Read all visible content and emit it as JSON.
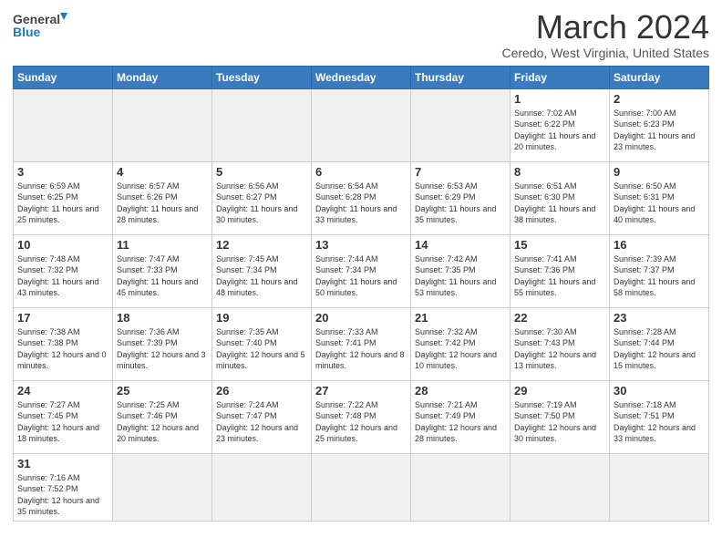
{
  "header": {
    "logo_general": "General",
    "logo_blue": "Blue",
    "title": "March 2024",
    "location": "Ceredo, West Virginia, United States"
  },
  "days_of_week": [
    "Sunday",
    "Monday",
    "Tuesday",
    "Wednesday",
    "Thursday",
    "Friday",
    "Saturday"
  ],
  "weeks": [
    [
      {
        "day": "",
        "info": ""
      },
      {
        "day": "",
        "info": ""
      },
      {
        "day": "",
        "info": ""
      },
      {
        "day": "",
        "info": ""
      },
      {
        "day": "",
        "info": ""
      },
      {
        "day": "1",
        "info": "Sunrise: 7:02 AM\nSunset: 6:22 PM\nDaylight: 11 hours\nand 20 minutes."
      },
      {
        "day": "2",
        "info": "Sunrise: 7:00 AM\nSunset: 6:23 PM\nDaylight: 11 hours\nand 23 minutes."
      }
    ],
    [
      {
        "day": "3",
        "info": "Sunrise: 6:59 AM\nSunset: 6:25 PM\nDaylight: 11 hours\nand 25 minutes."
      },
      {
        "day": "4",
        "info": "Sunrise: 6:57 AM\nSunset: 6:26 PM\nDaylight: 11 hours\nand 28 minutes."
      },
      {
        "day": "5",
        "info": "Sunrise: 6:56 AM\nSunset: 6:27 PM\nDaylight: 11 hours\nand 30 minutes."
      },
      {
        "day": "6",
        "info": "Sunrise: 6:54 AM\nSunset: 6:28 PM\nDaylight: 11 hours\nand 33 minutes."
      },
      {
        "day": "7",
        "info": "Sunrise: 6:53 AM\nSunset: 6:29 PM\nDaylight: 11 hours\nand 35 minutes."
      },
      {
        "day": "8",
        "info": "Sunrise: 6:51 AM\nSunset: 6:30 PM\nDaylight: 11 hours\nand 38 minutes."
      },
      {
        "day": "9",
        "info": "Sunrise: 6:50 AM\nSunset: 6:31 PM\nDaylight: 11 hours\nand 40 minutes."
      }
    ],
    [
      {
        "day": "10",
        "info": "Sunrise: 7:48 AM\nSunset: 7:32 PM\nDaylight: 11 hours\nand 43 minutes."
      },
      {
        "day": "11",
        "info": "Sunrise: 7:47 AM\nSunset: 7:33 PM\nDaylight: 11 hours\nand 45 minutes."
      },
      {
        "day": "12",
        "info": "Sunrise: 7:45 AM\nSunset: 7:34 PM\nDaylight: 11 hours\nand 48 minutes."
      },
      {
        "day": "13",
        "info": "Sunrise: 7:44 AM\nSunset: 7:34 PM\nDaylight: 11 hours\nand 50 minutes."
      },
      {
        "day": "14",
        "info": "Sunrise: 7:42 AM\nSunset: 7:35 PM\nDaylight: 11 hours\nand 53 minutes."
      },
      {
        "day": "15",
        "info": "Sunrise: 7:41 AM\nSunset: 7:36 PM\nDaylight: 11 hours\nand 55 minutes."
      },
      {
        "day": "16",
        "info": "Sunrise: 7:39 AM\nSunset: 7:37 PM\nDaylight: 11 hours\nand 58 minutes."
      }
    ],
    [
      {
        "day": "17",
        "info": "Sunrise: 7:38 AM\nSunset: 7:38 PM\nDaylight: 12 hours\nand 0 minutes."
      },
      {
        "day": "18",
        "info": "Sunrise: 7:36 AM\nSunset: 7:39 PM\nDaylight: 12 hours\nand 3 minutes."
      },
      {
        "day": "19",
        "info": "Sunrise: 7:35 AM\nSunset: 7:40 PM\nDaylight: 12 hours\nand 5 minutes."
      },
      {
        "day": "20",
        "info": "Sunrise: 7:33 AM\nSunset: 7:41 PM\nDaylight: 12 hours\nand 8 minutes."
      },
      {
        "day": "21",
        "info": "Sunrise: 7:32 AM\nSunset: 7:42 PM\nDaylight: 12 hours\nand 10 minutes."
      },
      {
        "day": "22",
        "info": "Sunrise: 7:30 AM\nSunset: 7:43 PM\nDaylight: 12 hours\nand 13 minutes."
      },
      {
        "day": "23",
        "info": "Sunrise: 7:28 AM\nSunset: 7:44 PM\nDaylight: 12 hours\nand 15 minutes."
      }
    ],
    [
      {
        "day": "24",
        "info": "Sunrise: 7:27 AM\nSunset: 7:45 PM\nDaylight: 12 hours\nand 18 minutes."
      },
      {
        "day": "25",
        "info": "Sunrise: 7:25 AM\nSunset: 7:46 PM\nDaylight: 12 hours\nand 20 minutes."
      },
      {
        "day": "26",
        "info": "Sunrise: 7:24 AM\nSunset: 7:47 PM\nDaylight: 12 hours\nand 23 minutes."
      },
      {
        "day": "27",
        "info": "Sunrise: 7:22 AM\nSunset: 7:48 PM\nDaylight: 12 hours\nand 25 minutes."
      },
      {
        "day": "28",
        "info": "Sunrise: 7:21 AM\nSunset: 7:49 PM\nDaylight: 12 hours\nand 28 minutes."
      },
      {
        "day": "29",
        "info": "Sunrise: 7:19 AM\nSunset: 7:50 PM\nDaylight: 12 hours\nand 30 minutes."
      },
      {
        "day": "30",
        "info": "Sunrise: 7:18 AM\nSunset: 7:51 PM\nDaylight: 12 hours\nand 33 minutes."
      }
    ],
    [
      {
        "day": "31",
        "info": "Sunrise: 7:16 AM\nSunset: 7:52 PM\nDaylight: 12 hours\nand 35 minutes."
      },
      {
        "day": "",
        "info": ""
      },
      {
        "day": "",
        "info": ""
      },
      {
        "day": "",
        "info": ""
      },
      {
        "day": "",
        "info": ""
      },
      {
        "day": "",
        "info": ""
      },
      {
        "day": "",
        "info": ""
      }
    ]
  ]
}
